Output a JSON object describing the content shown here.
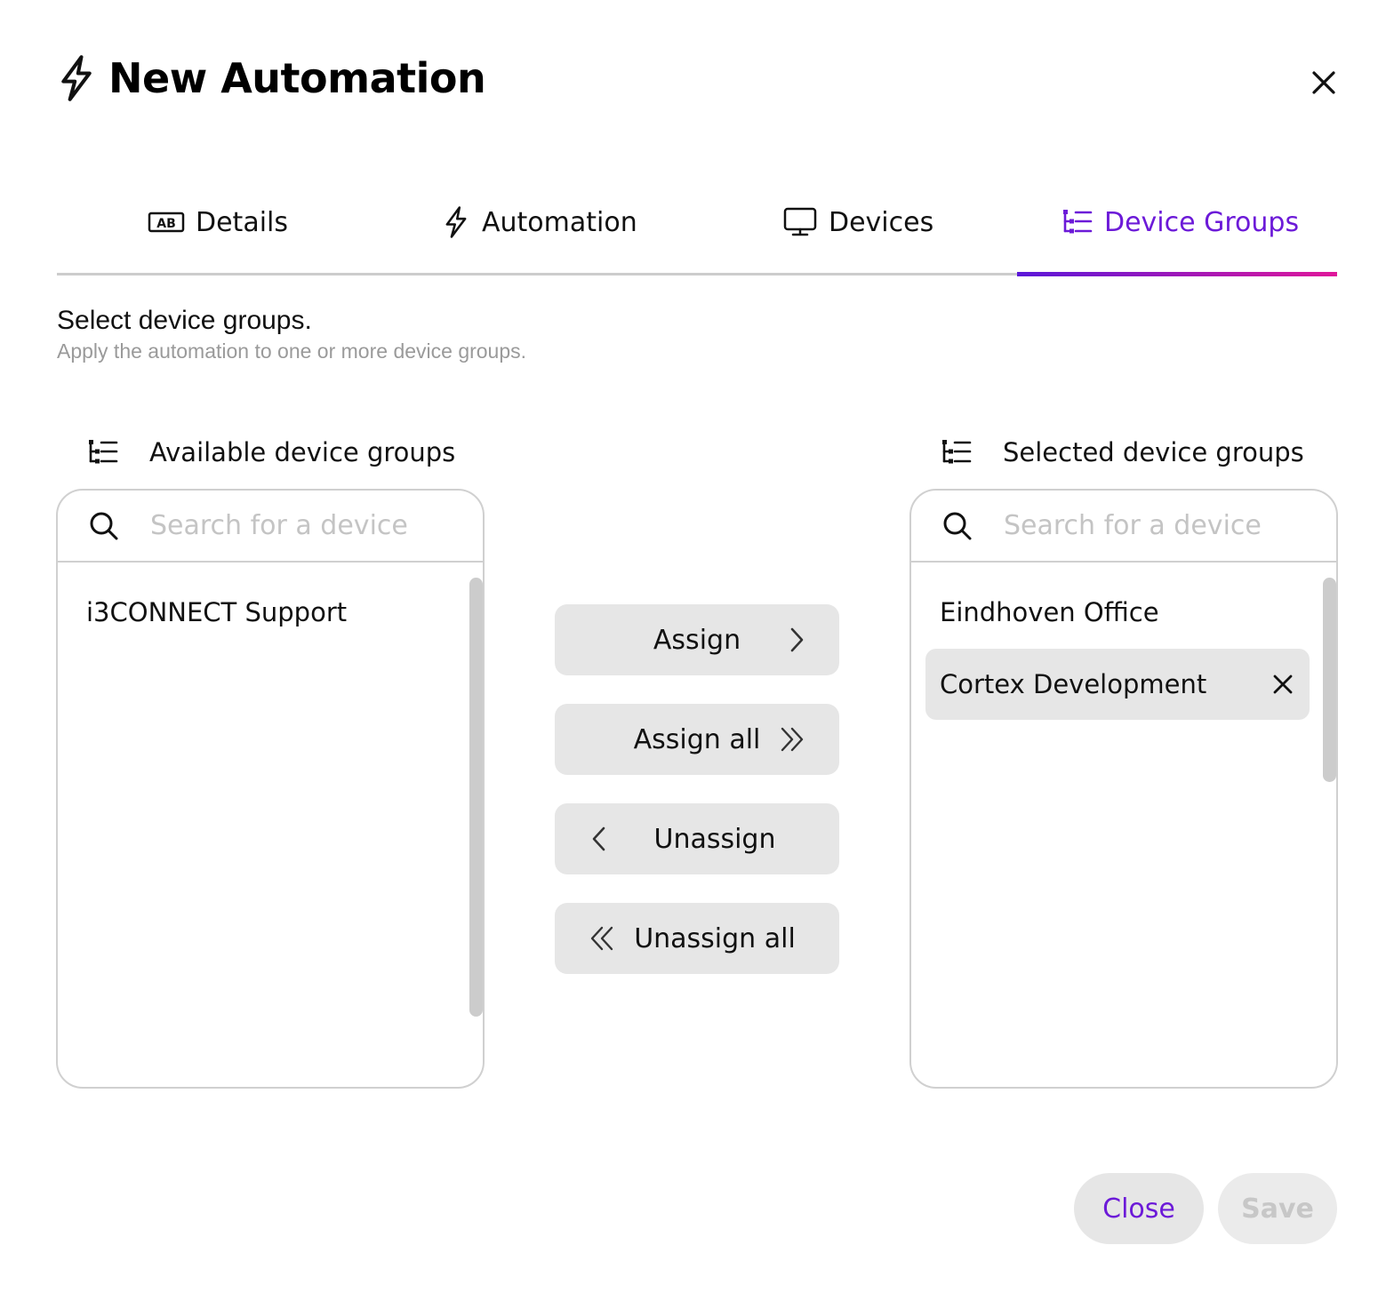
{
  "dialog": {
    "title": "New Automation"
  },
  "tabs": [
    {
      "label": "Details",
      "icon": "ab-label-icon"
    },
    {
      "label": "Automation",
      "icon": "bolt-icon"
    },
    {
      "label": "Devices",
      "icon": "monitor-icon"
    },
    {
      "label": "Device Groups",
      "icon": "device-groups-icon",
      "active": true
    }
  ],
  "section": {
    "title": "Select device groups.",
    "subtitle": "Apply the automation to one or more device groups."
  },
  "available": {
    "label": "Available device groups",
    "search_placeholder": "Search for a device",
    "items": [
      "i3CONNECT Support"
    ]
  },
  "selected": {
    "label": "Selected device groups",
    "search_placeholder": "Search for a device",
    "items": [
      "Eindhoven Office",
      "Cortex Development"
    ]
  },
  "actions": {
    "assign": "Assign",
    "assign_all": "Assign all",
    "unassign": "Unassign",
    "unassign_all": "Unassign all"
  },
  "footer": {
    "close": "Close",
    "save": "Save"
  },
  "colors": {
    "accent": "#6c1ad8",
    "accent_gradient_end": "#e0179a",
    "button_bg": "#e6e6e6"
  }
}
